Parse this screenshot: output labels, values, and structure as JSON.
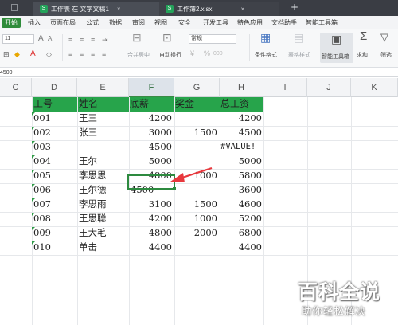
{
  "window": {
    "tabs": [
      {
        "label": "工作表 在 文字文稿1",
        "close": "×"
      },
      {
        "label": "工作簿2.xlsx",
        "close": "×"
      }
    ],
    "new_tab": "+"
  },
  "menu": {
    "start": "开始",
    "items": [
      "插入",
      "页面布局",
      "公式",
      "数据",
      "审阅",
      "视图",
      "安全",
      "开发工具",
      "特色应用",
      "文档助手",
      "智能工具箱"
    ]
  },
  "toolbar": {
    "font_size": "11",
    "number_format": "常规",
    "merge_center": "合并居中",
    "wrap_text": "自动换行",
    "conditional_format": "条件格式",
    "table_style": "表格样式",
    "smart_toolbox": "智能工具箱",
    "sum": "求和",
    "filter": "筛选",
    "percent": "%",
    "thousands": "000"
  },
  "formula_bar": {
    "value": "4500"
  },
  "grid": {
    "columns": [
      "C",
      "D",
      "E",
      "F",
      "G",
      "H",
      "I",
      "J",
      "K"
    ],
    "selected_column": "F",
    "header_row": {
      "id": "工号",
      "name": "姓名",
      "salary": "底薪",
      "bonus": "奖金",
      "total": "总工资"
    },
    "rows": [
      {
        "id": "001",
        "name": "王三",
        "salary": "4200",
        "bonus": "",
        "total": "4200"
      },
      {
        "id": "002",
        "name": "张三",
        "salary": "3000",
        "bonus": "1500",
        "total": "4500"
      },
      {
        "id": "003",
        "name": "",
        "salary": "4500",
        "bonus": "",
        "total": "#VALUE!"
      },
      {
        "id": "004",
        "name": "王尔",
        "salary": "5000",
        "bonus": "",
        "total": "5000"
      },
      {
        "id": "005",
        "name": "李思思",
        "salary": "4800",
        "bonus": "1000",
        "total": "5800"
      },
      {
        "id": "006",
        "name": "王尔德",
        "salary": "4500",
        "bonus": "",
        "total": "3600"
      },
      {
        "id": "007",
        "name": "李思雨",
        "salary": "3100",
        "bonus": "1500",
        "total": "4600"
      },
      {
        "id": "008",
        "name": "王思聪",
        "salary": "4200",
        "bonus": "1000",
        "total": "5200"
      },
      {
        "id": "009",
        "name": "王大毛",
        "salary": "4800",
        "bonus": "2000",
        "total": "6800"
      },
      {
        "id": "010",
        "name": "单击",
        "salary": "4400",
        "bonus": "",
        "total": "4400"
      }
    ],
    "accent_color": "#27a44b",
    "arrow_color": "#e8383d"
  },
  "watermark": {
    "title": "百科全说",
    "subtitle": "助你轻松解决"
  }
}
